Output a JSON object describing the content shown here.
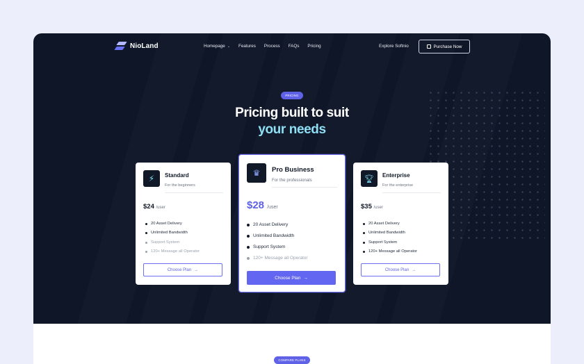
{
  "brand": {
    "name": "NioLand"
  },
  "nav": {
    "items": [
      {
        "label": "Homepage",
        "has_dropdown": true
      },
      {
        "label": "Features",
        "has_dropdown": false
      },
      {
        "label": "Process",
        "has_dropdown": false
      },
      {
        "label": "FAQs",
        "has_dropdown": false
      },
      {
        "label": "Pricing",
        "has_dropdown": false
      }
    ],
    "explore": "Explore Softnio",
    "purchase": "Purchase Now"
  },
  "hero": {
    "badge": "PRICING",
    "title_line1": "Pricing built to suit",
    "title_line2": "your needs"
  },
  "plans": [
    {
      "name": "Standard",
      "subtitle": "For the beginners",
      "price": "$24",
      "period": "/user",
      "features": [
        "20 Asset Delivery",
        "Unlimited Bandwidth",
        "Support System",
        "120+ Message all Operator"
      ],
      "features_available": [
        true,
        true,
        false,
        false
      ],
      "cta": "Choose Plan",
      "icon": "lightning-icon"
    },
    {
      "name": "Pro Business",
      "subtitle": "For the professionals",
      "price": "$28",
      "period": "/user",
      "features": [
        "20 Asset Delivery",
        "Unlimited Bandwidth",
        "Support System",
        "120+ Message all Operator"
      ],
      "features_available": [
        true,
        true,
        true,
        false
      ],
      "cta": "Choose Plan",
      "icon": "crown-icon"
    },
    {
      "name": "Enterprise",
      "subtitle": "For the enterprise",
      "price": "$35",
      "period": "/user",
      "features": [
        "20 Asset Delivery",
        "Unlimited Bandwidth",
        "Support System",
        "120+ Message all Operator"
      ],
      "features_available": [
        true,
        true,
        true,
        true
      ],
      "cta": "Choose Plan",
      "icon": "trophy-icon"
    }
  ],
  "compare": {
    "badge": "COMPARE PLANS"
  },
  "colors": {
    "background": "#eceffb",
    "hero": "#0f1627",
    "accent": "#6366f1",
    "highlight_text": "#8fe0f5"
  }
}
